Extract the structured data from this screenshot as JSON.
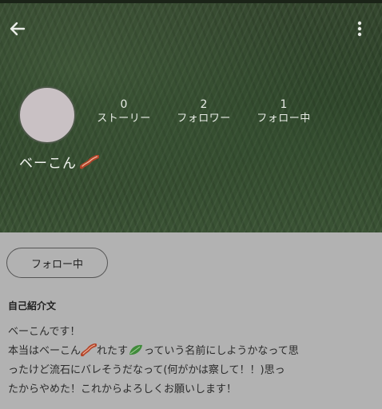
{
  "profile": {
    "username": "ベーこん",
    "username_emoji": "bacon-icon",
    "stats": [
      {
        "value": "0",
        "label": "ストーリー"
      },
      {
        "value": "2",
        "label": "フォロワー"
      },
      {
        "value": "1",
        "label": "フォロー中"
      }
    ]
  },
  "actions": {
    "follow_label": "フォロー中"
  },
  "bio": {
    "title": "自己紹介文",
    "lines": [
      {
        "text": "ベーこんです！"
      },
      {
        "a": "本当はベーこん",
        "b": "れたす",
        "c": "っていう名前にしようかなって思"
      },
      {
        "text": "ったけど流石にバレそうだなって(何がかは察して！！)思っ"
      },
      {
        "text": "たからやめた！これからよろしくお願いします！"
      }
    ]
  },
  "icons": {
    "back": "arrow-left-icon",
    "more": "more-vertical-icon",
    "bacon": "bacon-icon",
    "lettuce": "lettuce-leaf-icon"
  },
  "colors": {
    "header_bg": "#2f4529",
    "page_bg": "#b2b2b2",
    "avatar": "#c9c1c4",
    "bacon": "#c0522b",
    "lettuce": "#3f8a3a"
  }
}
